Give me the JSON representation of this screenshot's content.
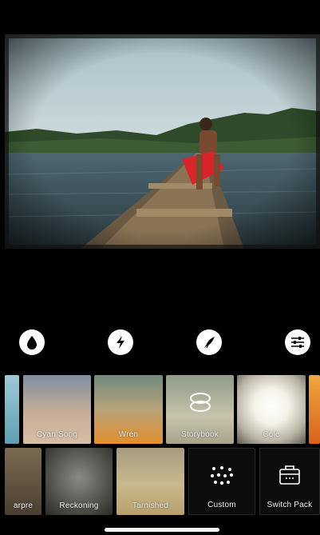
{
  "photo": {
    "alt_icon": "canoe-photo"
  },
  "tools": [
    {
      "icon": "droplet-icon"
    },
    {
      "icon": "lightning-icon"
    },
    {
      "icon": "bird-icon"
    },
    {
      "icon": "sliders-icon"
    }
  ],
  "textures": [
    {
      "label": ""
    },
    {
      "label": "Cyan Song"
    },
    {
      "label": "Wren"
    },
    {
      "label": "Storybook"
    },
    {
      "label": "Cole"
    },
    {
      "label": ""
    }
  ],
  "overlays": [
    {
      "label": "arpre"
    },
    {
      "label": "Reckoning"
    },
    {
      "label": "Tarnished"
    },
    {
      "label": "Custom"
    },
    {
      "label": "Switch Pack"
    }
  ]
}
